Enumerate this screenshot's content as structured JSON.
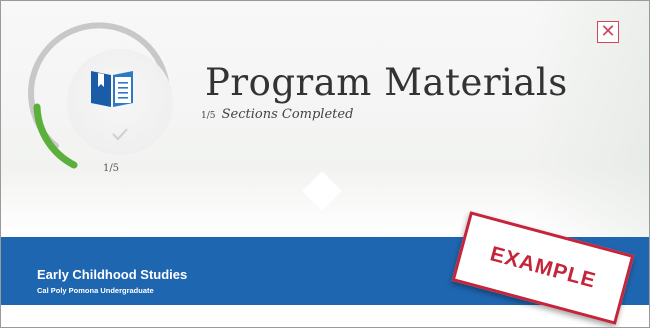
{
  "header": {
    "title": "Program Materials",
    "progress_fraction_text": "1/5",
    "progress_suffix": "Sections Completed",
    "progress_label": "1/5",
    "progress_value": 0.2,
    "close_symbol": "✕",
    "icon": "open-book-icon"
  },
  "program": {
    "name": "Early Childhood Studies",
    "subtitle": "Cal Poly Pomona Undergraduate"
  },
  "stamp": {
    "label": "EXAMPLE"
  },
  "colors": {
    "accent_blue": "#1f66b1",
    "progress_green": "#5bb03b",
    "ring_gray": "#c8c8c8",
    "close_red": "#c94756",
    "stamp_red": "#c5253a"
  }
}
